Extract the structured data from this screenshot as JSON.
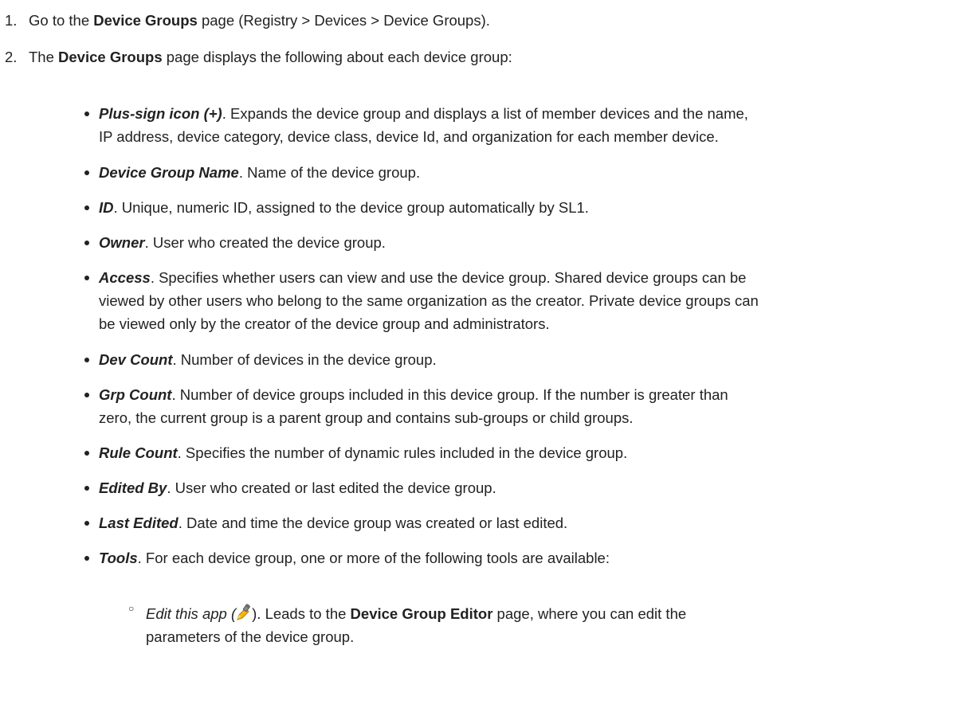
{
  "steps": [
    {
      "number": "1.",
      "pre": "Go to the ",
      "bold": "Device Groups",
      "post": " page (Registry > Devices > Device Groups)."
    },
    {
      "number": "2.",
      "pre": "The ",
      "bold": "Device Groups",
      "post": " page displays the following about each device group:"
    }
  ],
  "bullets": [
    {
      "term": "Plus-sign icon (+)",
      "line1": ". Expands the device group and displays a list of member devices and the name,",
      "line2": "IP address, device category, device class, device Id, and organization for each member device."
    },
    {
      "term": "Device Group Name",
      "line1": ". Name of the device group."
    },
    {
      "term": "ID",
      "line1": ". Unique, numeric ID, assigned to the device group automatically by SL1."
    },
    {
      "term": "Owner",
      "line1": ". User who created the device group."
    },
    {
      "term": "Access",
      "line1": ". Specifies whether users can view and use the device group. Shared device groups can be",
      "line2": "viewed by other users who belong to the same organization as the creator. Private device groups can",
      "line3": "be viewed only by the creator of the device group and administrators."
    },
    {
      "term": "Dev Count",
      "line1": ". Number of devices in the device group."
    },
    {
      "term": "Grp Count",
      "line1": ". Number of device groups included in this device group. If the number is greater than",
      "line2": "zero, the current group is a parent group and contains sub-groups or child groups."
    },
    {
      "term": "Rule Count",
      "line1": ". Specifies the number of dynamic rules included in the device group."
    },
    {
      "term": "Edited By",
      "line1": ". User who created or last edited the device group."
    },
    {
      "term": "Last Edited",
      "line1": ". Date and time the device group was created or last edited."
    },
    {
      "term": "Tools",
      "line1": ". For each device group, one or more of the following tools are available:"
    }
  ],
  "sub_bullets": [
    {
      "italic": "Edit this app (",
      "icon": "edit-wrench-pencil-icon",
      "after_icon": "). Leads to the ",
      "bold": "Device Group Editor",
      "post": " page, where you can edit the",
      "line2": "parameters of the device group."
    }
  ]
}
